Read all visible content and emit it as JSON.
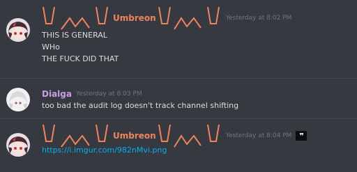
{
  "messages": [
    {
      "author": "Umbreon",
      "timestamp": "Yesterday at 8:02 PM",
      "lines": [
        "THIS IS GENERAL",
        "WHo",
        "THE FUCK DID THAT"
      ]
    },
    {
      "author": "Dialga",
      "timestamp": "Yesterday at 8:03 PM",
      "lines": [
        "too bad the audit log doesn't track channel shifting"
      ]
    },
    {
      "author": "Umbreon",
      "timestamp": "Yesterday at 8:04 PM",
      "link": "https://i.imgur.com/982nMvi.png",
      "quote_icon": "quote-icon"
    }
  ],
  "colors": {
    "background": "#36393f",
    "umbreon_name": "#f0845f",
    "dialga_name": "#c59ee8",
    "timestamp": "#72767d",
    "link": "#00b0f4"
  }
}
